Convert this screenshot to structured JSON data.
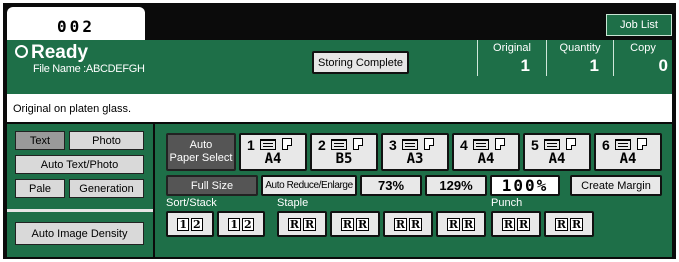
{
  "job": {
    "number": "002"
  },
  "header": {
    "job_list_label": "Job List"
  },
  "status": {
    "ready_label": "Ready",
    "file_name": "File Name :ABCDEFGH",
    "storing_label": "Storing Complete",
    "original_label": "Original",
    "original_value": "1",
    "quantity_label": "Quantity",
    "quantity_value": "1",
    "copy_label": "Copy",
    "copy_value": "0"
  },
  "message": "Original on platen glass.",
  "image_mode": {
    "text_label": "Text",
    "photo_label": "Photo",
    "auto_text_photo_label": "Auto Text/Photo",
    "pale_label": "Pale",
    "generation_label": "Generation",
    "auto_density_label": "Auto Image Density"
  },
  "paper": {
    "auto_line1": "Auto",
    "auto_line2": "Paper Select",
    "trays": [
      {
        "num": "1",
        "size": "A4"
      },
      {
        "num": "2",
        "size": "B5"
      },
      {
        "num": "3",
        "size": "A3"
      },
      {
        "num": "4",
        "size": "A4"
      },
      {
        "num": "5",
        "size": "A4"
      },
      {
        "num": "6",
        "size": "A4"
      }
    ]
  },
  "reduce": {
    "full_size_label": "Full Size",
    "auto_reduce_label": "Auto Reduce/Enlarge",
    "preset_73": "73%",
    "preset_129": "129%",
    "ratio_value": "100%",
    "create_margin_label": "Create Margin"
  },
  "finishing": {
    "sort_stack_label": "Sort/Stack",
    "staple_label": "Staple",
    "punch_label": "Punch",
    "glyph_r": "R",
    "glyph_1": "1",
    "glyph_2": "2"
  },
  "icons": [
    "paper-tray-icon",
    "paper-sheet-icon",
    "sort-icon",
    "stack-icon",
    "staple-icon",
    "punch-icon"
  ],
  "colors": {
    "panel_green": "#1e6f48",
    "frame": "#0b0b0b",
    "button_face": "#e8e8e8",
    "selected_gray": "#9a9a9a",
    "dark_button": "#555555"
  }
}
